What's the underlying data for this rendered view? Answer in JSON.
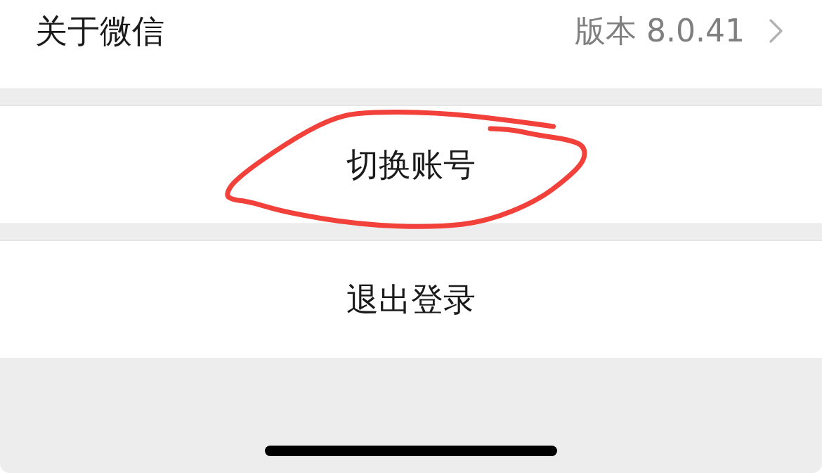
{
  "rows": [
    {
      "kind": "detail",
      "label": "关于微信",
      "value": "版本 8.0.41",
      "circled": false
    },
    {
      "kind": "action",
      "label": "切换账号",
      "circled": true
    },
    {
      "kind": "action",
      "label": "退出登录",
      "circled": false
    }
  ]
}
